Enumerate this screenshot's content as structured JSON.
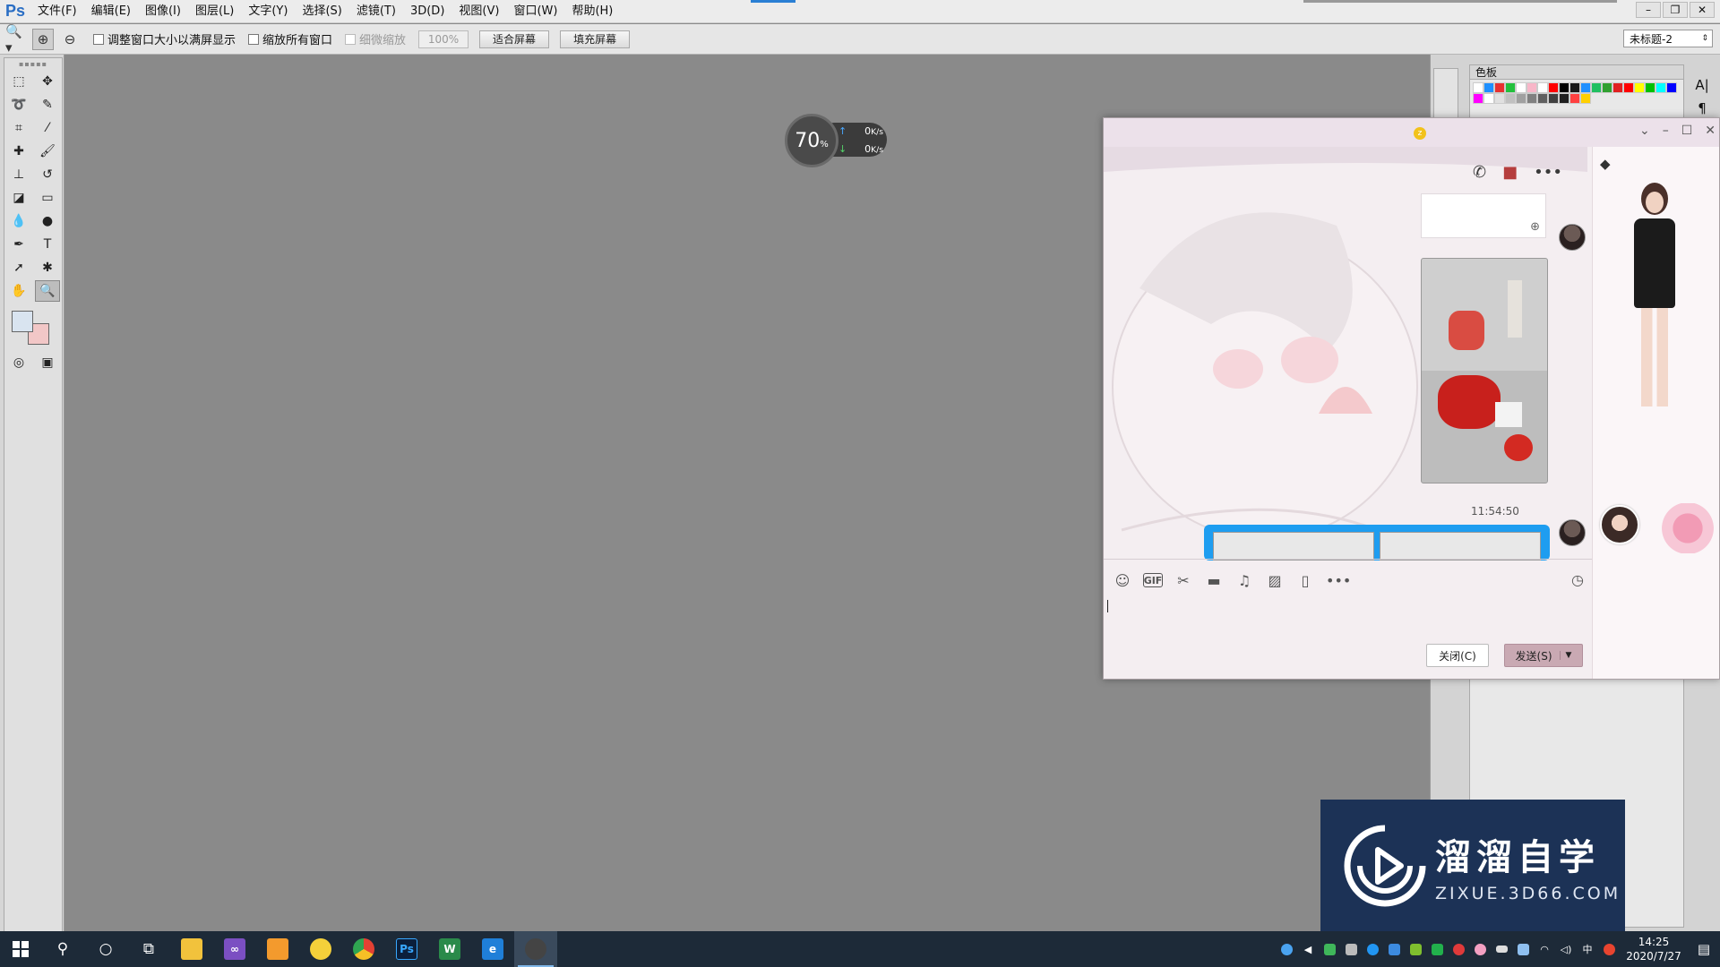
{
  "photoshop": {
    "logo": "Ps",
    "menu": [
      "文件(F)",
      "编辑(E)",
      "图像(I)",
      "图层(L)",
      "文字(Y)",
      "选择(S)",
      "滤镜(T)",
      "3D(D)",
      "视图(V)",
      "窗口(W)",
      "帮助(H)"
    ],
    "options": {
      "check_resize_windows": "调整窗口大小以满屏显示",
      "check_zoom_all": "缩放所有窗口",
      "check_scrubby": "细微缩放",
      "zoom_value": "100%",
      "btn_fit_screen": "适合屏幕",
      "btn_fill_screen": "填充屏幕"
    },
    "document_select": "未标题-2",
    "swatches_tab": "色板",
    "swatch_colors": [
      "#ffffff",
      "#1e90ff",
      "#e83030",
      "#22c03c",
      "#ffffff",
      "#f8b6c8",
      "#ffffff",
      "#ff0000",
      "#000000",
      "#1a1a1a",
      "#2090ff",
      "#20c060",
      "#30a030",
      "#e02020",
      "#ff0000",
      "#ffff00",
      "#00c000",
      "#00ffff",
      "#0000ff",
      "#ff00ff",
      "#ffffff",
      "#e0e0e0",
      "#c0c0c0",
      "#a0a0a0",
      "#808080",
      "#606060",
      "#404040",
      "#202020",
      "#ff4040",
      "#ffd000"
    ],
    "foreground_color": "#d9e4f0",
    "background_color": "#f2c7c7"
  },
  "net_widget": {
    "percent": "70",
    "percent_unit": "%",
    "upload": "0",
    "download": "0",
    "unit": "K/s"
  },
  "chat": {
    "timestamp": "11:54:50",
    "close_button": "关闭(C)",
    "send_button": "发送(S)"
  },
  "watermark": {
    "cn": "溜溜自学",
    "en": "ZIXUE.3D66.COM"
  },
  "taskbar": {
    "time": "14:25",
    "date": "2020/7/27",
    "ime": "中"
  }
}
